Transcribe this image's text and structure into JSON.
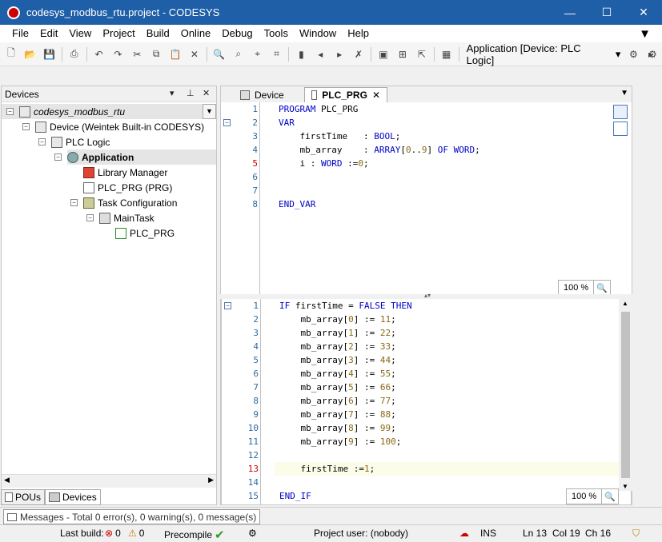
{
  "window": {
    "title": "codesys_modbus_rtu.project - CODESYS",
    "minimize": "—",
    "maximize": "☐",
    "close": "✕"
  },
  "menu": [
    "File",
    "Edit",
    "View",
    "Project",
    "Build",
    "Online",
    "Debug",
    "Tools",
    "Window",
    "Help"
  ],
  "toolbar": {
    "application": "Application [Device: PLC Logic]"
  },
  "devices_panel": {
    "title": "Devices",
    "tree": [
      {
        "label": "codesys_modbus_rtu",
        "icon": "project-icon",
        "italic": true
      },
      {
        "label": "Device (Weintek Built-in CODESYS)",
        "icon": "device-icon"
      },
      {
        "label": "PLC Logic",
        "icon": "plc-logic-icon"
      },
      {
        "label": "Application",
        "icon": "application-gear-icon",
        "bold": true
      },
      {
        "label": "Library Manager",
        "icon": "library-books-icon"
      },
      {
        "label": "PLC_PRG (PRG)",
        "icon": "pou-icon"
      },
      {
        "label": "Task Configuration",
        "icon": "task-config-icon"
      },
      {
        "label": "MainTask",
        "icon": "task-icon"
      },
      {
        "label": "PLC_PRG",
        "icon": "pou-call-icon"
      }
    ],
    "tabs": [
      "POUs",
      "Devices"
    ]
  },
  "editor": {
    "tabs": [
      "Device",
      "PLC_PRG"
    ],
    "decl_lines": [
      {
        "n": "1",
        "code": "PROGRAM PLC_PRG"
      },
      {
        "n": "2",
        "code": "VAR"
      },
      {
        "n": "3",
        "code": "    firstTime   : BOOL;"
      },
      {
        "n": "4",
        "code": "    mb_array    : ARRAY[0..9] OF WORD;"
      },
      {
        "n": "5",
        "code": "    i : WORD :=0;"
      },
      {
        "n": "6",
        "code": ""
      },
      {
        "n": "7",
        "code": ""
      },
      {
        "n": "8",
        "code": "END_VAR"
      }
    ],
    "impl_lines": [
      {
        "n": "1",
        "code": "IF firstTime = FALSE THEN"
      },
      {
        "n": "2",
        "code": "    mb_array[0] := 11;"
      },
      {
        "n": "3",
        "code": "    mb_array[1] := 22;"
      },
      {
        "n": "4",
        "code": "    mb_array[2] := 33;"
      },
      {
        "n": "5",
        "code": "    mb_array[3] := 44;"
      },
      {
        "n": "6",
        "code": "    mb_array[4] := 55;"
      },
      {
        "n": "7",
        "code": "    mb_array[5] := 66;"
      },
      {
        "n": "8",
        "code": "    mb_array[6] := 77;"
      },
      {
        "n": "9",
        "code": "    mb_array[7] := 88;"
      },
      {
        "n": "10",
        "code": "    mb_array[8] := 99;"
      },
      {
        "n": "11",
        "code": "    mb_array[9] := 100;"
      },
      {
        "n": "12",
        "code": ""
      },
      {
        "n": "13",
        "code": "    firstTime :=1;"
      },
      {
        "n": "14",
        "code": ""
      },
      {
        "n": "15",
        "code": "END_IF"
      }
    ],
    "zoom_decl": "100 %",
    "zoom_impl": "100 %"
  },
  "messages": {
    "text": "Messages - Total 0 error(s), 0 warning(s), 0 message(s)"
  },
  "statusbar": {
    "last_build": "Last build:",
    "errors": "0",
    "warnings": "0",
    "precompile": "Precompile",
    "project_user": "Project user: (nobody)",
    "ins": "INS",
    "ln": "Ln 13",
    "col": "Col 19",
    "ch": "Ch 16"
  }
}
